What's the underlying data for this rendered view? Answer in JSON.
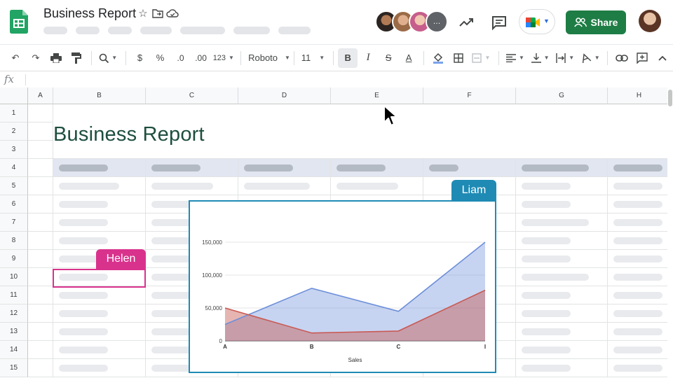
{
  "header": {
    "title": "Business Report",
    "share_label": "Share",
    "avatar_more_label": "…",
    "icons": [
      "star-icon",
      "move-folder-icon",
      "cloud-saved-icon",
      "activity-trend-icon",
      "comments-icon",
      "meet-icon",
      "people-icon"
    ]
  },
  "toolbar": {
    "zoom_label": "",
    "currency_label": "$",
    "percent_label": "%",
    "decrease_decimal_label": ".0",
    "increase_decimal_label": ".00",
    "format_label": "123",
    "font_label": "Roboto",
    "font_size_label": "11"
  },
  "formula_bar": {
    "fx_label": "fx"
  },
  "sheet": {
    "columns": [
      "A",
      "B",
      "C",
      "D",
      "E",
      "F",
      "G",
      "H"
    ],
    "rows": [
      "1",
      "2",
      "3",
      "4",
      "5",
      "6",
      "7",
      "8",
      "9",
      "10",
      "11",
      "12",
      "13",
      "14",
      "15"
    ],
    "title": "Business Report"
  },
  "collaborators": {
    "helen": "Helen",
    "liam": "Liam"
  },
  "colors": {
    "helen": "#d9328d",
    "liam": "#1f8bb5",
    "share_button": "#1e7d45",
    "header_row": "#e1e6f1",
    "title_text": "#1d4e3f"
  },
  "chart_data": {
    "type": "area",
    "categories": [
      "A",
      "B",
      "C",
      "I"
    ],
    "series": [
      {
        "values": [
          25000,
          80000,
          45000,
          150000
        ],
        "color": "#6d8fd9"
      },
      {
        "values": [
          50000,
          12000,
          15000,
          77000
        ],
        "color": "#c85a55"
      }
    ],
    "xlabel": "Sales",
    "ylabel": "",
    "yticks": [
      "0",
      "50,000",
      "100,000",
      "150,000"
    ],
    "ylim": [
      0,
      150000
    ],
    "grid": true
  }
}
